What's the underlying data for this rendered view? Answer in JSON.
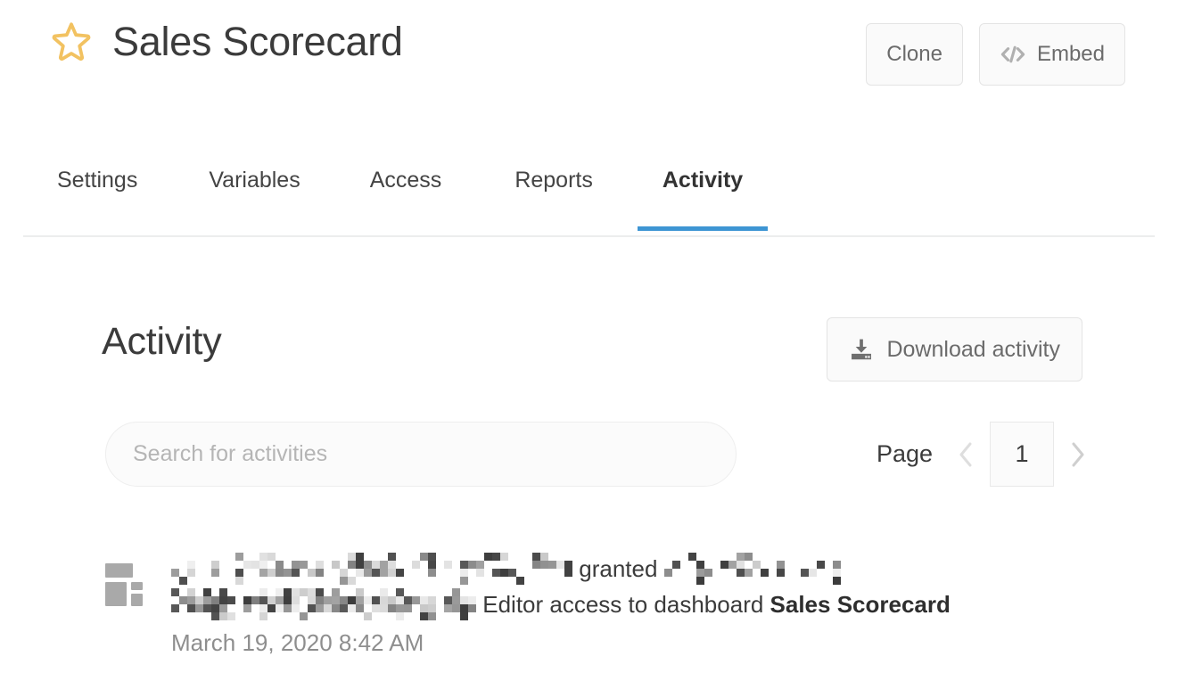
{
  "header": {
    "title": "Sales Scorecard",
    "star_icon": "star-outline-icon",
    "star_color": "#f2c261",
    "actions": [
      {
        "label": "Clone",
        "icon": null,
        "name": "clone-button"
      },
      {
        "label": "Embed",
        "icon": "code-icon",
        "name": "embed-button"
      }
    ]
  },
  "tabs": {
    "items": [
      {
        "label": "Settings",
        "active": false
      },
      {
        "label": "Variables",
        "active": false
      },
      {
        "label": "Access",
        "active": false
      },
      {
        "label": "Reports",
        "active": false
      },
      {
        "label": "Activity",
        "active": true
      }
    ],
    "active_color": "#3d95d3"
  },
  "main": {
    "section_title": "Activity",
    "download_button": {
      "label": "Download activity",
      "icon": "download-icon"
    },
    "search": {
      "placeholder": "Search for activities",
      "value": ""
    },
    "pagination": {
      "label": "Page",
      "current_page": "1",
      "prev_icon": "chevron-left-icon",
      "next_icon": "chevron-right-icon",
      "prev_enabled": false,
      "next_enabled": true
    },
    "activities": [
      {
        "icon": "dashboard-icon",
        "line1_redacted_before": true,
        "line1_text": "granted",
        "line1_redacted_after": true,
        "line2_redacted_before": true,
        "line2_text": "Editor access to dashboard ",
        "line2_bold": "Sales Scorecard",
        "timestamp": "March 19, 2020 8:42 AM"
      }
    ]
  }
}
